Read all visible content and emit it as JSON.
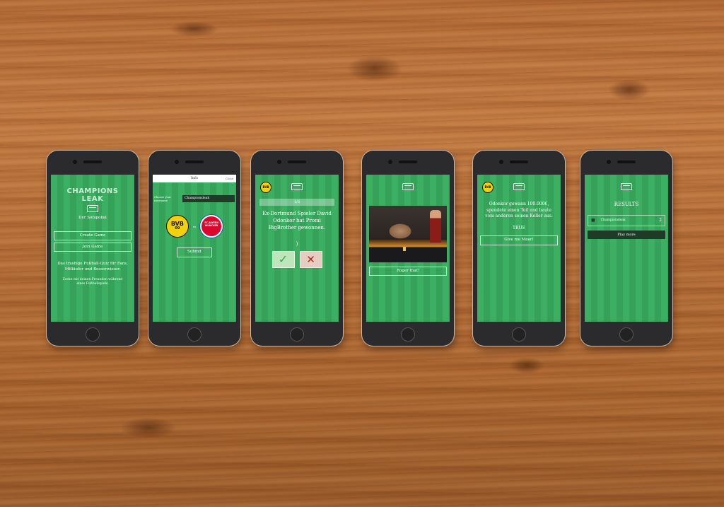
{
  "brand_colors": {
    "pitch_light": "#3daf62",
    "pitch_dark": "#35a159",
    "dark_bar": "#1f3a27",
    "bvb_yellow": "#f4d00a",
    "fcb_red": "#dc052d"
  },
  "screen1": {
    "title": "Champions Leak",
    "sofa_icon": "sofa-icon",
    "subtitle": "Der Sofapokal",
    "create_label": "Create Game",
    "join_label": "Join Game",
    "tagline": "Das trashige Fußball-Quiz für Fans, Mitläufer und Besserwisser.",
    "hint": "Zocke mit deinen Freunden während eines Fußballspiels."
  },
  "screen2": {
    "topbar_title": "Info",
    "topbar_close": "Close",
    "username_label": "Choose your username",
    "username_value": "Championsleak",
    "team1_badge": "BVB",
    "team1_year": "09",
    "vs": "vs",
    "team2_badge": "FC BAYERN MÜNCHEN",
    "submit_label": "Submit"
  },
  "screen3": {
    "team_badge": "BVB",
    "progress": "1/3",
    "question": "Ex-Dortmund Spieler David Odonkor hat Promi BigBrother gewonnen.",
    "spinner": ")",
    "true_icon": "✓",
    "false_icon": "✕"
  },
  "screen4": {
    "image_alt": "Star Trek reaction gif",
    "button_label": "Roger that!"
  },
  "screen5": {
    "team_badge": "BVB",
    "statement": "Odonkor gewann 100.000€, spendete einen Teil und baute vom anderen seinen Keller aus.",
    "result": "TRUE",
    "button_label": "Give me Moar!"
  },
  "screen6": {
    "title": "Results",
    "row_name": "Championsleak",
    "row_score": "2",
    "play_label": "Play more"
  }
}
